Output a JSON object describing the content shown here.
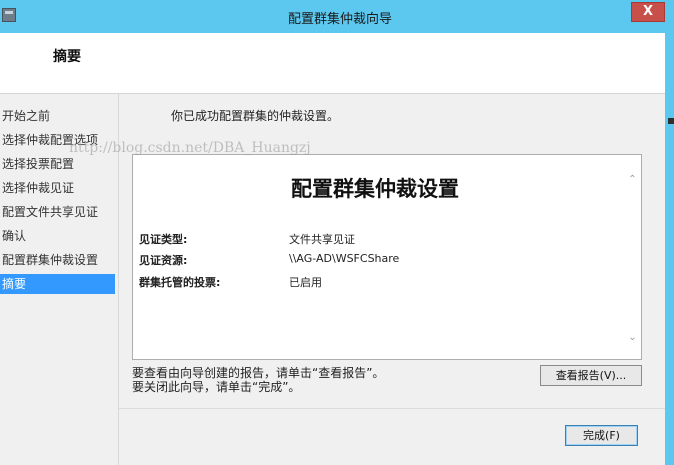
{
  "window": {
    "title": "配置群集仲裁向导",
    "close_symbol": "X",
    "icon": "server-manager-icon"
  },
  "header": {
    "heading": "摘要"
  },
  "nav": {
    "items": [
      {
        "label": "开始之前"
      },
      {
        "label": "选择仲裁配置选项"
      },
      {
        "label": "选择投票配置"
      },
      {
        "label": "选择仲裁见证"
      },
      {
        "label": "配置文件共享见证"
      },
      {
        "label": "确认"
      },
      {
        "label": "配置群集仲裁设置"
      },
      {
        "label": "摘要",
        "active": true
      }
    ]
  },
  "main": {
    "success_message": "你已成功配置群集的仲裁设置。",
    "report": {
      "title": "配置群集仲裁设置",
      "rows": [
        {
          "label": "见证类型:",
          "value": "文件共享见证"
        },
        {
          "label": "见证资源:",
          "value": "\\\\AG-AD\\WSFCShare"
        },
        {
          "label": "群集托管的投票:",
          "value": "已启用"
        }
      ]
    },
    "instructions": {
      "line1": "要查看由向导创建的报告，请单击“查看报告”。",
      "line2": "要关闭此向导，请单击“完成”。"
    },
    "view_report_button": "查看报告(V)...",
    "finish_button": "完成(F)"
  },
  "watermark": "http://blog.csdn.net/DBA_Huangzj",
  "colors": {
    "title_bar": "#5cc8ef",
    "close_button": "#c7504b",
    "nav_selected": "#3399ff"
  }
}
